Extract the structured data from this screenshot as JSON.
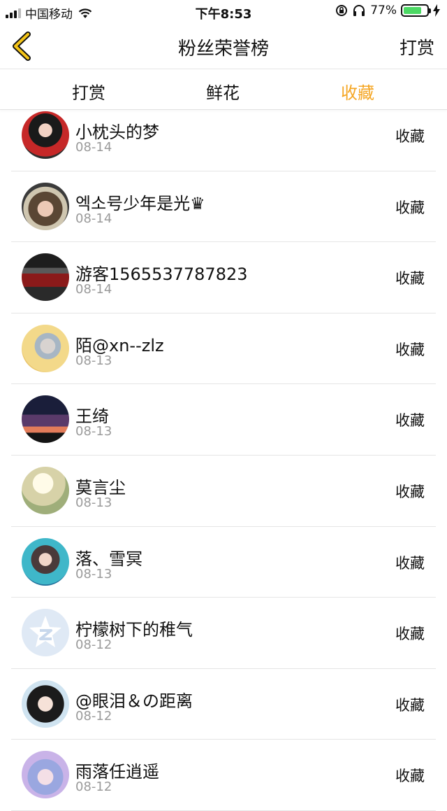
{
  "status_bar": {
    "carrier": "中国移动",
    "time": "下午8:53",
    "battery_text": "77%",
    "battery_level": 0.77,
    "battery_color": "#4cd964"
  },
  "nav": {
    "back_icon": "chevron-left-icon",
    "title": "粉丝荣誉榜",
    "right_label": "打赏"
  },
  "tabs": [
    {
      "label": "打赏",
      "active": false
    },
    {
      "label": "鲜花",
      "active": false
    },
    {
      "label": "收藏",
      "active": true
    }
  ],
  "accent_color": "#f5a623",
  "rows": [
    {
      "name": "小枕头的梦",
      "date": "08-14",
      "action": "收藏",
      "avatar": "user-photo"
    },
    {
      "name": "엑소号少年是光♛",
      "date": "08-14",
      "action": "收藏",
      "avatar": "user-photo"
    },
    {
      "name": "游客1565537787823",
      "date": "08-14",
      "action": "收藏",
      "avatar": "user-photo"
    },
    {
      "name": "陌@xn--zlz",
      "date": "08-13",
      "action": "收藏",
      "avatar": "user-photo"
    },
    {
      "name": "王绮",
      "date": "08-13",
      "action": "收藏",
      "avatar": "user-photo"
    },
    {
      "name": "莫言尘",
      "date": "08-13",
      "action": "收藏",
      "avatar": "user-photo"
    },
    {
      "name": "落、雪冥",
      "date": "08-13",
      "action": "收藏",
      "avatar": "user-photo"
    },
    {
      "name": "柠檬树下的稚气",
      "date": "08-12",
      "action": "收藏",
      "avatar": "default-avatar"
    },
    {
      "name": "@眼泪＆の距离",
      "date": "08-12",
      "action": "收藏",
      "avatar": "user-photo"
    },
    {
      "name": "雨落任逍遥",
      "date": "08-12",
      "action": "收藏",
      "avatar": "user-photo"
    }
  ]
}
